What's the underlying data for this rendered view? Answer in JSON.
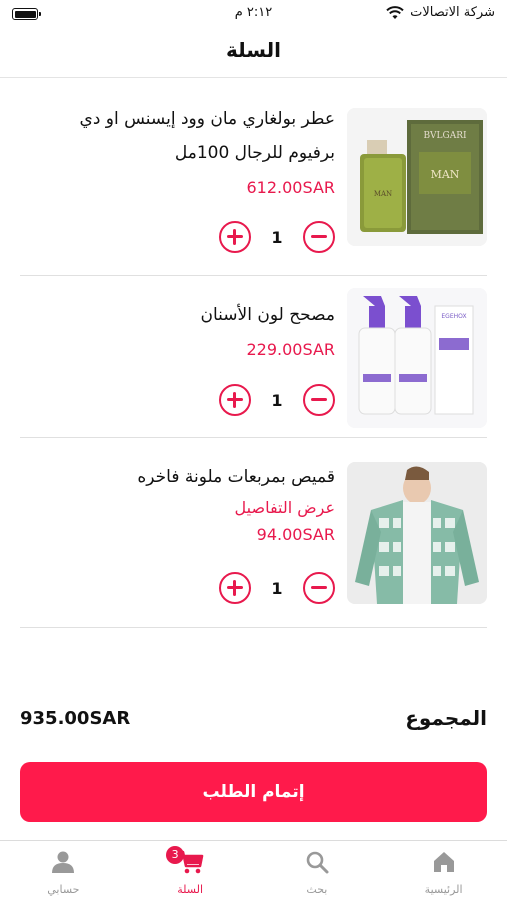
{
  "status_bar": {
    "carrier": "شركة الاتصالات",
    "time": "٢:١٢ م"
  },
  "header": {
    "title": "السلة"
  },
  "cart": {
    "items": [
      {
        "name_line1": "عطر بولغاري مان وود إيسنس او دي",
        "name_line2": "برفيوم للرجال 100مل",
        "price": "612.00SAR",
        "quantity": "1",
        "image_brand": "BVLGARI",
        "image_label": "MAN"
      },
      {
        "name_line1": "مصحح لون الأسنان",
        "price": "229.00SAR",
        "quantity": "1",
        "image_brand": "EGEHOX"
      },
      {
        "name_line1": "قميص بمربعات ملونة فاخره",
        "details_link": "عرض التفاصيل",
        "price": "94.00SAR",
        "quantity": "1"
      }
    ]
  },
  "total": {
    "label": "المجموع",
    "value": "935.00SAR"
  },
  "checkout": {
    "label": "إتمام الطلب"
  },
  "tab_bar": {
    "tabs": [
      {
        "label": "الرئيسية",
        "icon": "home-icon"
      },
      {
        "label": "بحث",
        "icon": "search-icon"
      },
      {
        "label": "السلة",
        "icon": "cart-icon",
        "badge": "3",
        "active": true
      },
      {
        "label": "حسابي",
        "icon": "user-icon"
      }
    ]
  },
  "colors": {
    "accent": "#e8194d",
    "button": "#ff1a4b",
    "inactive": "#999999"
  }
}
